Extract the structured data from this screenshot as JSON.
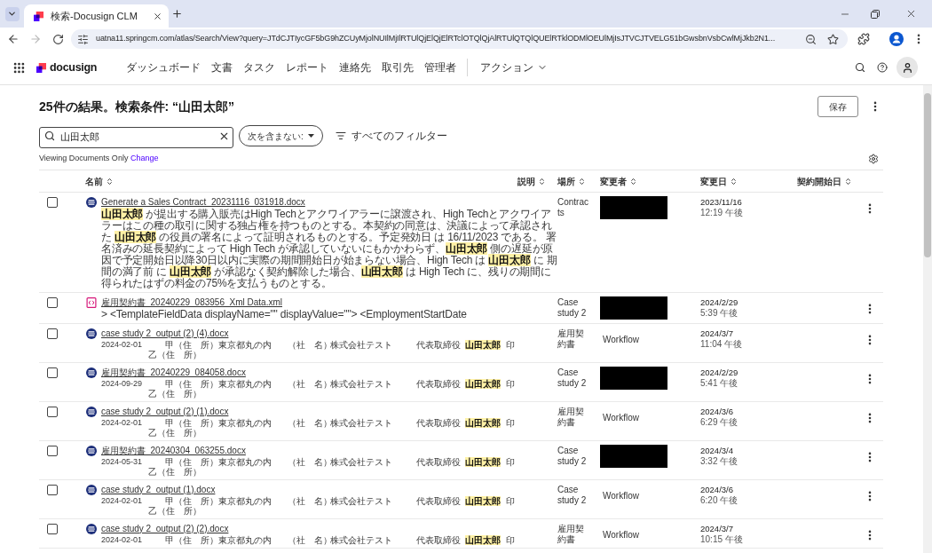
{
  "browser": {
    "tab_title": "検索-Docusign CLM",
    "url": "uatna11.springcm.com/atlas/Search/View?query=JTdCJTIycGF5bG9hZCUyMjolNUIlMjIlRTUlQjElQjElRTclOTQlQjAlRTUlQTQlQUElRTklODMlOEUlMjIsJTVCJTVELG51bGwsbnVsbCwlMjJkb2N1...",
    "forward_disabled": true
  },
  "app_header": {
    "logo": "docusign",
    "nav": [
      {
        "label": "ダッシュボード",
        "kind": "link"
      },
      {
        "label": "文書",
        "kind": "link"
      },
      {
        "label": "タスク",
        "kind": "link"
      },
      {
        "label": "レポート",
        "kind": "link"
      },
      {
        "label": "連絡先",
        "kind": "link"
      },
      {
        "label": "取引先",
        "kind": "link"
      },
      {
        "label": "管理者",
        "kind": "link"
      },
      {
        "label": "アクション",
        "kind": "menu"
      }
    ]
  },
  "page": {
    "title": "25件の結果。検索条件: “山田太郎”",
    "save_button": "保存"
  },
  "search": {
    "value": "山田太郎",
    "exclude_dropdown": "次を含まない:",
    "all_filters": "すべてのフィルター"
  },
  "view_notice": {
    "text": "Viewing Documents Only",
    "link": "Change"
  },
  "table": {
    "columns": [
      "名前",
      "説明",
      "場所",
      "変更者",
      "変更日",
      "契約開始日"
    ],
    "rows": [
      {
        "checked": false,
        "kind": "docx",
        "name": "Generate a Sales Contract_20231116_031918.docx",
        "snippet": {
          "kind": "paragraph",
          "text": "**山田太郎** が提出する購入販売はHigh Techとアクワイアラーに譲渡され、High Techとアクワイアラーはこの種の取引に関する独占権を持つものとする。本契約の同意は、決議によって承認された **山田太郎** の役員の署名によって証明されるものとする。予定発効日 は 16/11/2023 である。 署名済みの延長契約によって High Tech が承認していないにもかかわらず、**山田太郎** 側の遅延が原因で予定開始日以降30日以内に実際の期間開始日が始まらない場合、High Tech は **山田太郎** に 期間の満了前 に **山田太郎** が承認なく契約解除した場合、**山田太郎** は High Tech に、残りの期間に得られたはずの料金の75%を支払うものとする。"
        },
        "location": "Contracts",
        "modified_by": {
          "kind": "redacted"
        },
        "modified_date": "2023/11/16",
        "modified_time": "12:19 午後"
      },
      {
        "checked": false,
        "kind": "xml",
        "name": "雇用契約書_20240229_083956_Xml Data.xml",
        "snippet": {
          "kind": "paragraph",
          "text": "> <TemplateFieldData displayName=\"\" displayValue=\"\"> <EmploymentStartDate"
        },
        "location": "Case study 2",
        "modified_by": {
          "kind": "redacted"
        },
        "modified_date": "2024/2/29",
        "modified_time": "5:39 午後"
      },
      {
        "checked": false,
        "kind": "docx",
        "name": "case study 2_output (2) (4).docx",
        "snippet": {
          "kind": "fields",
          "lines": [
            [
              {
                "text": "2024-02-01",
                "highlight": false
              },
              {
                "text": "甲（住　所）",
                "highlight": false
              },
              {
                "text": "東京都丸の内",
                "highlight": false
              },
              {
                "text": "（社　名）",
                "highlight": false
              },
              {
                "text": "株式会社テスト",
                "highlight": false
              },
              {
                "text": "代表取締役",
                "highlight": false
              },
              {
                "text": "山田太郎",
                "highlight": true
              },
              {
                "text": "印",
                "highlight": false
              }
            ],
            [
              {
                "text": "乙（住　所）",
                "highlight": false
              }
            ]
          ]
        },
        "location": "雇用契約書",
        "modified_by": {
          "kind": "text",
          "text": "Workflow"
        },
        "modified_date": "2024/3/7",
        "modified_time": "11:04 午後"
      },
      {
        "checked": false,
        "kind": "docx",
        "name": "雇用契約書_20240229_084058.docx",
        "snippet": {
          "kind": "fields",
          "lines": [
            [
              {
                "text": "2024-09-29",
                "highlight": false
              },
              {
                "text": "甲（住　所）",
                "highlight": false
              },
              {
                "text": "東京都丸の内",
                "highlight": false
              },
              {
                "text": "（社　名）",
                "highlight": false
              },
              {
                "text": "株式会社テスト",
                "highlight": false
              },
              {
                "text": "代表取締役",
                "highlight": false
              },
              {
                "text": "山田太郎",
                "highlight": true
              },
              {
                "text": "印",
                "highlight": false
              }
            ],
            [
              {
                "text": "乙（住　所）",
                "highlight": false
              }
            ]
          ]
        },
        "location": "Case study 2",
        "modified_by": {
          "kind": "redacted"
        },
        "modified_date": "2024/2/29",
        "modified_time": "5:41 午後"
      },
      {
        "checked": false,
        "kind": "docx",
        "name": "case study 2_output (2) (1).docx",
        "snippet": {
          "kind": "fields",
          "lines": [
            [
              {
                "text": "2024-02-01",
                "highlight": false
              },
              {
                "text": "甲（住　所）",
                "highlight": false
              },
              {
                "text": "東京都丸の内",
                "highlight": false
              },
              {
                "text": "（社　名）",
                "highlight": false
              },
              {
                "text": "株式会社テスト",
                "highlight": false
              },
              {
                "text": "代表取締役",
                "highlight": false
              },
              {
                "text": "山田太郎",
                "highlight": true
              },
              {
                "text": "印",
                "highlight": false
              }
            ],
            [
              {
                "text": "乙（住　所）",
                "highlight": false
              }
            ]
          ]
        },
        "location": "雇用契約書",
        "modified_by": {
          "kind": "text",
          "text": "Workflow"
        },
        "modified_date": "2024/3/6",
        "modified_time": "6:29 午後"
      },
      {
        "checked": false,
        "kind": "docx",
        "name": "雇用契約書_20240304_063255.docx",
        "snippet": {
          "kind": "fields",
          "lines": [
            [
              {
                "text": "2024-05-31",
                "highlight": false
              },
              {
                "text": "甲（住　所）",
                "highlight": false
              },
              {
                "text": "東京都丸の内",
                "highlight": false
              },
              {
                "text": "（社　名）",
                "highlight": false
              },
              {
                "text": "株式会社テスト",
                "highlight": false
              },
              {
                "text": "代表取締役",
                "highlight": false
              },
              {
                "text": "山田太郎",
                "highlight": true
              },
              {
                "text": "印",
                "highlight": false
              }
            ],
            [
              {
                "text": "乙（住　所）",
                "highlight": false
              }
            ]
          ]
        },
        "location": "Case study 2",
        "modified_by": {
          "kind": "redacted"
        },
        "modified_date": "2024/3/4",
        "modified_time": "3:32 午後"
      },
      {
        "checked": false,
        "kind": "docx",
        "name": "case study 2_output (1).docx",
        "snippet": {
          "kind": "fields",
          "lines": [
            [
              {
                "text": "2024-02-01",
                "highlight": false
              },
              {
                "text": "甲（住　所）",
                "highlight": false
              },
              {
                "text": "東京都丸の内",
                "highlight": false
              },
              {
                "text": "（社　名）",
                "highlight": false
              },
              {
                "text": "株式会社テスト",
                "highlight": false
              },
              {
                "text": "代表取締役",
                "highlight": false
              },
              {
                "text": "山田太郎",
                "highlight": true
              },
              {
                "text": "印",
                "highlight": false
              }
            ],
            [
              {
                "text": "乙（住　所）",
                "highlight": false
              }
            ]
          ]
        },
        "location": "Case study 2",
        "modified_by": {
          "kind": "text",
          "text": "Workflow"
        },
        "modified_date": "2024/3/6",
        "modified_time": "6:20 午後"
      },
      {
        "checked": false,
        "kind": "docx",
        "name": "case study 2_output (2) (2).docx",
        "snippet": {
          "kind": "fields",
          "lines": [
            [
              {
                "text": "2024-02-01",
                "highlight": false
              },
              {
                "text": "甲（住　所）",
                "highlight": false
              },
              {
                "text": "東京都丸の内",
                "highlight": false
              },
              {
                "text": "（社　名）",
                "highlight": false
              },
              {
                "text": "株式会社テスト",
                "highlight": false
              },
              {
                "text": "代表取締役",
                "highlight": false
              },
              {
                "text": "山田太郎",
                "highlight": true
              },
              {
                "text": "印",
                "highlight": false
              }
            ]
          ]
        },
        "location": "雇用契約書",
        "modified_by": {
          "kind": "text",
          "text": "Workflow"
        },
        "modified_date": "2024/3/7",
        "modified_time": "10:15 午後"
      }
    ]
  }
}
